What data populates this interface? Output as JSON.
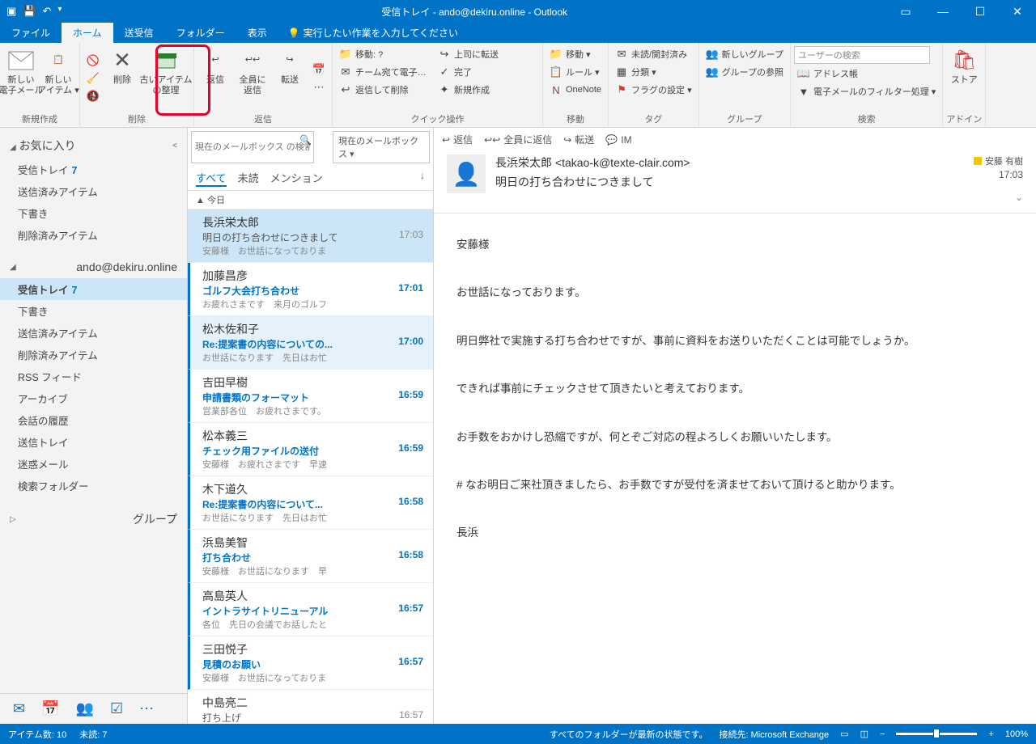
{
  "title": "受信トレイ - ando@dekiru.online - Outlook",
  "tabs": {
    "file": "ファイル",
    "home": "ホーム",
    "sendrecv": "送受信",
    "folder": "フォルダー",
    "view": "表示",
    "tell": "実行したい作業を入力してください"
  },
  "ribbon": {
    "new_mail": "新しい\n電子メール",
    "new_item": "新しい\nアイテム ▾",
    "g_new": "新規作成",
    "delete": "削除",
    "archive": "古いアイテム\nの整理",
    "g_delete": "削除",
    "reply": "返信",
    "reply_all": "全員に\n返信",
    "forward": "転送",
    "g_reply": "返信",
    "qs_move": "移動: ?",
    "qs_team": "チーム宛て電子…",
    "qs_replydel": "返信して削除",
    "qs_boss": "上司に転送",
    "qs_done": "完了",
    "qs_new": "新規作成",
    "g_qs": "クイック操作",
    "move": "移動 ▾",
    "rules": "ルール ▾",
    "onenote": "OneNote",
    "g_move": "移動",
    "unread": "未読/開封済み",
    "categorize": "分類 ▾",
    "flag": "フラグの設定 ▾",
    "g_tag": "タグ",
    "newgroup": "新しいグループ",
    "browsegroup": "グループの参照",
    "g_group": "グループ",
    "search_ph": "ユーザーの検索",
    "addrbook": "アドレス帳",
    "filter": "電子メールのフィルター処理 ▾",
    "g_search": "検索",
    "store": "ストア",
    "g_addin": "アドイン"
  },
  "nav": {
    "fav": "お気に入り",
    "fav_items": [
      {
        "l": "受信トレイ",
        "c": "7"
      },
      {
        "l": "送信済みアイテム"
      },
      {
        "l": "下書き"
      },
      {
        "l": "削除済みアイテム"
      }
    ],
    "acct": "ando@dekiru.online",
    "acct_items": [
      {
        "l": "受信トレイ",
        "c": "7",
        "sel": true
      },
      {
        "l": "下書き"
      },
      {
        "l": "送信済みアイテム"
      },
      {
        "l": "削除済みアイテム"
      },
      {
        "l": "RSS フィード"
      },
      {
        "l": "アーカイブ"
      },
      {
        "l": "会話の履歴"
      },
      {
        "l": "送信トレイ"
      },
      {
        "l": "迷惑メール"
      },
      {
        "l": "検索フォルダー"
      }
    ],
    "groups": "グループ"
  },
  "msglist": {
    "search_ph": "現在のメールボックス の検索",
    "scope": "現在のメールボックス ▾",
    "tab_all": "すべて",
    "tab_unread": "未読",
    "tab_mention": "メンション",
    "sort": "↓",
    "date_hdr": "▲ 今日",
    "items": [
      {
        "from": "長浜栄太郎",
        "subj": "明日の打ち合わせにつきまして",
        "prev": "安藤様　お世話になっておりま",
        "time": "17:03"
      },
      {
        "from": "加藤昌彦",
        "subj": "ゴルフ大会打ち合わせ",
        "prev": "お疲れさまです　来月のゴルフ",
        "time": "17:01",
        "unread": true
      },
      {
        "from": "松木佐和子",
        "subj": "Re:提案書の内容についての...",
        "prev": "お世話になります　先日はお忙",
        "time": "17:00",
        "unread": true
      },
      {
        "from": "吉田早樹",
        "subj": "申請書類のフォーマット",
        "prev": "営業部各位　お疲れさまです。",
        "time": "16:59",
        "unread": true
      },
      {
        "from": "松本義三",
        "subj": "チェック用ファイルの送付",
        "prev": "安藤様　お疲れさまです　早速",
        "time": "16:59",
        "unread": true
      },
      {
        "from": "木下道久",
        "subj": "Re:提案書の内容について...",
        "prev": "お世話になります　先日はお忙",
        "time": "16:58",
        "unread": true
      },
      {
        "from": "浜島美智",
        "subj": "打ち合わせ",
        "prev": "安藤様　お世話になります　早",
        "time": "16:58",
        "unread": true
      },
      {
        "from": "高島英人",
        "subj": "イントラサイトリニューアル",
        "prev": "各位　先日の会議でお話したと",
        "time": "16:57",
        "unread": true
      },
      {
        "from": "三田悦子",
        "subj": "見積のお願い",
        "prev": "安藤様　お世話になっておりま",
        "time": "16:57",
        "unread": true
      },
      {
        "from": "中島亮二",
        "subj": "打ち上げ",
        "prev": "",
        "time": "16:57"
      }
    ]
  },
  "reading": {
    "act_reply": "返信",
    "act_replyall": "全員に返信",
    "act_fwd": "転送",
    "act_im": "IM",
    "from": "長浜栄太郎 <takao-k@texte-clair.com>",
    "category": "安藤 有樹",
    "time": "17:03",
    "subject": "明日の打ち合わせにつきまして",
    "body": "安藤様\n\nお世話になっております。\n\n明日弊社で実施する打ち合わせですが、事前に資料をお送りいただくことは可能でしょうか。\n\nできれば事前にチェックさせて頂きたいと考えております。\n\nお手数をおかけし恐縮ですが、何とぞご対応の程よろしくお願いいたします。\n\n#  なお明日ご来社頂きましたら、お手数ですが受付を済ませておいて頂けると助かります。\n\n長浜"
  },
  "status": {
    "items": "アイテム数: 10",
    "unread": "未読: 7",
    "sync": "すべてのフォルダーが最新の状態です。",
    "conn": "接続先: Microsoft Exchange",
    "zoom": "100%"
  }
}
